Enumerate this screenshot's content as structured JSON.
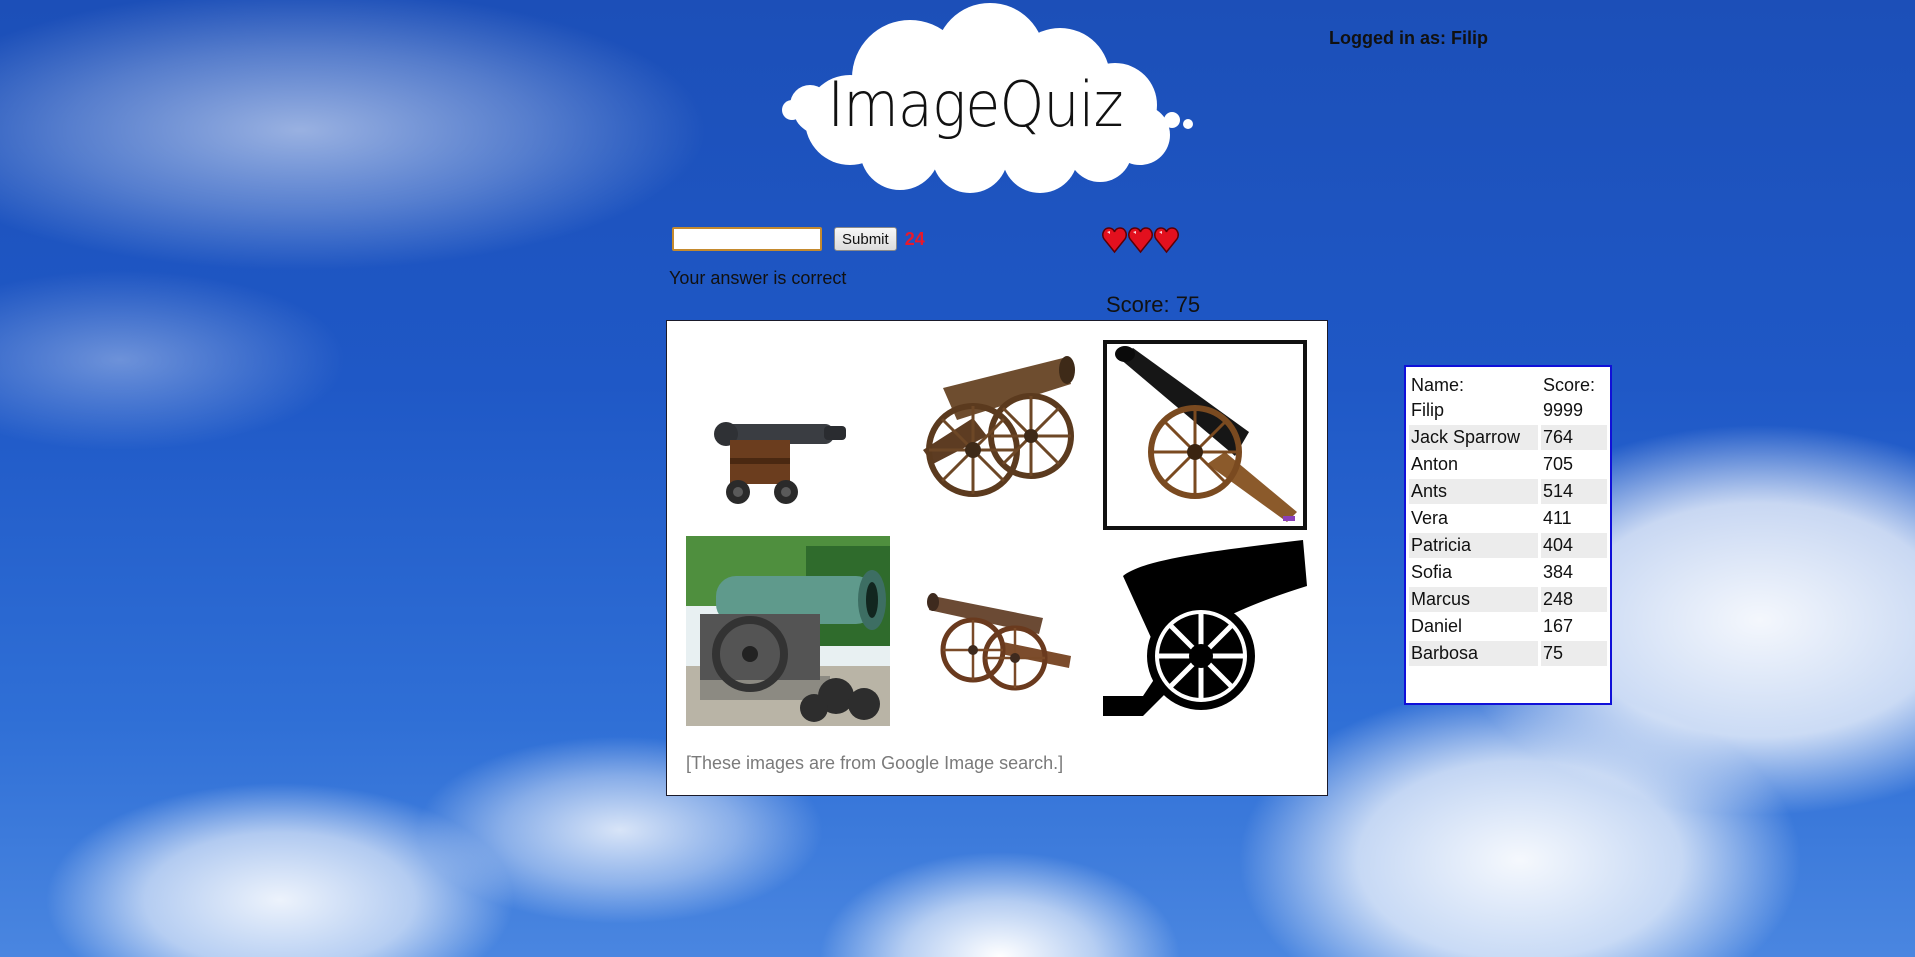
{
  "header": {
    "login_label": "Logged in as: Filip",
    "logo_text": "ImageQuiz"
  },
  "quiz": {
    "answer_value": "",
    "submit_label": "Submit",
    "timer": "24",
    "feedback": "Your answer is correct",
    "lives": 3,
    "score_label": "Score: 75",
    "credit": "[These images are from Google Image search.]",
    "images": [
      {
        "icon": "cannon-dark-wood-icon",
        "selected": false
      },
      {
        "icon": "cannon-bronze-large-wheels-icon",
        "selected": false
      },
      {
        "icon": "cannon-black-tilted-icon",
        "selected": true
      },
      {
        "icon": "tsar-cannon-photo-icon",
        "selected": false
      },
      {
        "icon": "cannon-small-brown-icon",
        "selected": false
      },
      {
        "icon": "cannon-silhouette-icon",
        "selected": false
      }
    ]
  },
  "highscores": {
    "headers": {
      "name": "Name:",
      "score": "Score:"
    },
    "rows": [
      {
        "name": "Filip",
        "score": "9999"
      },
      {
        "name": "Jack Sparrow",
        "score": "764"
      },
      {
        "name": "Anton",
        "score": "705"
      },
      {
        "name": "Ants",
        "score": "514"
      },
      {
        "name": "Vera",
        "score": "411"
      },
      {
        "name": "Patricia",
        "score": "404"
      },
      {
        "name": "Sofia",
        "score": "384"
      },
      {
        "name": "Marcus",
        "score": "248"
      },
      {
        "name": "Daniel",
        "score": "167"
      },
      {
        "name": "Barbosa",
        "score": "75"
      }
    ]
  },
  "colors": {
    "timer": "#e8192c",
    "heart": "#e3101e",
    "highscore_border": "#1010d8",
    "input_border": "#c58a2e"
  }
}
